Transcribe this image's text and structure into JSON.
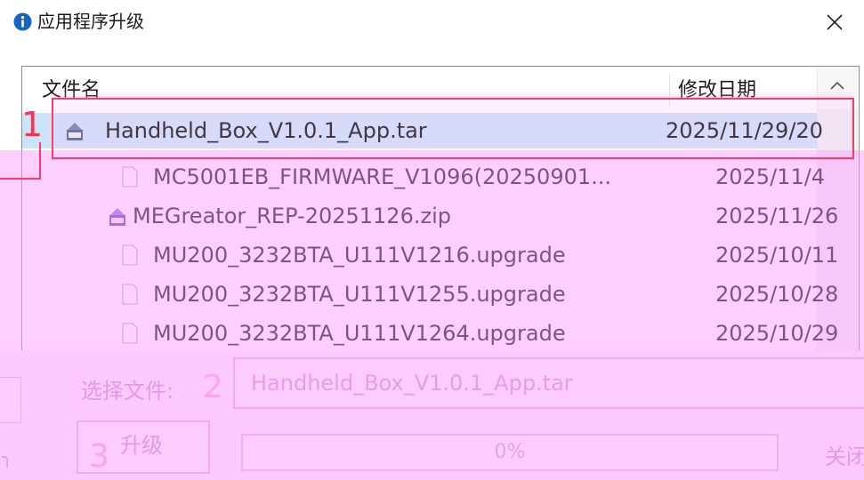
{
  "window": {
    "title": "应用程序升级",
    "icon": "info-icon",
    "close_icon": "close-icon"
  },
  "file_list": {
    "columns": {
      "name": "文件名",
      "modified": "修改日期"
    },
    "rows": [
      {
        "icon": "tar-archive-icon",
        "name": "Handheld_Box_V1.0.1_App.tar",
        "date": "2025/11/29/20",
        "selected": true
      },
      {
        "icon": "file-icon",
        "name": "MC5001EB_FIRMWARE_V1096(20250901...",
        "date": "2025/11/4"
      },
      {
        "icon": "zip-archive-icon",
        "name": "MEGreator_REP-20251126.zip",
        "date": "2025/11/26"
      },
      {
        "icon": "file-icon",
        "name": "MU200_3232BTA_U111V1216.upgrade",
        "date": "2025/10/11"
      },
      {
        "icon": "file-icon",
        "name": "MU200_3232BTA_U111V1255.upgrade",
        "date": "2025/10/28"
      },
      {
        "icon": "file-icon",
        "name": "MU200_3232BTA_U111V1264.upgrade",
        "date": "2025/10/29"
      }
    ]
  },
  "form": {
    "select_label": "选择文件:",
    "selected_file": "Handheld_Box_V1.0.1_App.tar",
    "upgrade_label": "升级",
    "progress_percent": 0,
    "progress_text": "0%",
    "close_label": "关闭"
  },
  "annotations": {
    "step1": "1",
    "step2": "2",
    "step3": "3"
  },
  "colors": {
    "selection": "#cce4f7",
    "annotation": "#ff3a6a",
    "overlay": "#ff96ff"
  }
}
